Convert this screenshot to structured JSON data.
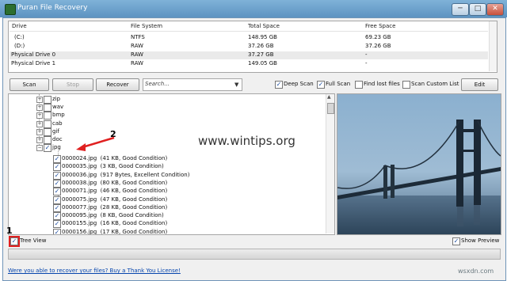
{
  "window": {
    "title": "Puran File Recovery"
  },
  "window_buttons": {
    "minimize": "─",
    "maximize": "□",
    "close": "✕"
  },
  "drive_list": {
    "headers": [
      "Drive",
      "File System",
      "Total Space",
      "Free Space"
    ],
    "rows": [
      {
        "drive": "(C:)",
        "fs": "NTFS",
        "total": "148.95 GB",
        "free": "69.23 GB"
      },
      {
        "drive": "(D:)",
        "fs": "RAW",
        "total": "37.26 GB",
        "free": "37.26 GB"
      },
      {
        "drive": "Physical Drive 0",
        "fs": "RAW",
        "total": "37.27 GB",
        "free": "-"
      },
      {
        "drive": "Physical Drive 1",
        "fs": "RAW",
        "total": "149.05 GB",
        "free": "-"
      }
    ]
  },
  "toolbar": {
    "scan": "Scan",
    "stop": "Stop",
    "recover": "Recover",
    "search_placeholder": "Search...",
    "deep_scan": "Deep Scan",
    "full_scan": "Full Scan",
    "find_lost_files": "Find lost files",
    "scan_custom_list": "Scan Custom List",
    "edit": "Edit"
  },
  "tree": {
    "folders": [
      "zip",
      "wav",
      "bmp",
      "cab",
      "gif",
      "doc",
      "jpg"
    ],
    "files": [
      "0000024.jpg  (41 KB, Good Condition)",
      "0000035.jpg  (3 KB, Good Condition)",
      "0000036.jpg  (917 Bytes, Excellent Condition)",
      "0000038.jpg  (80 KB, Good Condition)",
      "0000071.jpg  (46 KB, Good Condition)",
      "0000075.jpg  (47 KB, Good Condition)",
      "0000077.jpg  (28 KB, Good Condition)",
      "0000095.jpg  (8 KB, Good Condition)",
      "0000155.jpg  (16 KB, Good Condition)",
      "0000156.jpg  (17 KB, Good Condition)"
    ]
  },
  "watermark": "www.wintips.org",
  "annotations": {
    "one": "1",
    "two": "2"
  },
  "bottom": {
    "tree_view": "Tree View",
    "show_preview": "Show Preview",
    "buy_link": "Were you able to recover your files? Buy a Thank You License!"
  },
  "corner_watermark": "wsxdn.com",
  "colors": {
    "accent": "#3e6fa3",
    "annotation_red": "#e02020",
    "link": "#0645ad"
  }
}
